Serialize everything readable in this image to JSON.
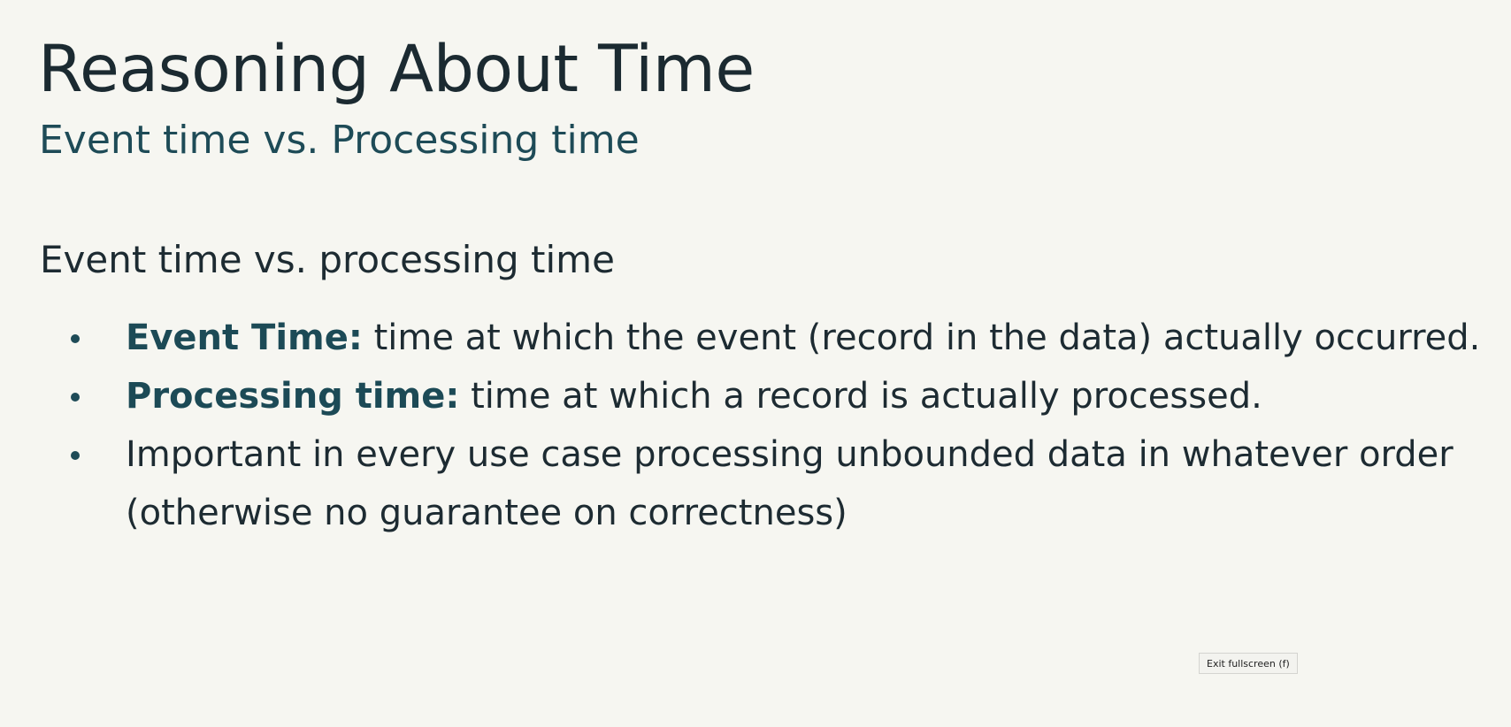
{
  "slide": {
    "title": "Reasoning About Time",
    "subtitle": "Event time vs. Processing time",
    "section_heading": "Event time vs. processing time",
    "bullets": [
      {
        "term": "Event Time:",
        "text": " time at which the event (record in the data) actually occurred."
      },
      {
        "term": "Processing time:",
        "text": " time at which a record is actually processed."
      },
      {
        "term": "",
        "text": "Important in every use case processing unbounded data in whatever order (otherwise no guarantee on correctness)"
      }
    ]
  },
  "controls": {
    "exit_fullscreen_label": "Exit fullscreen (f)"
  },
  "colors": {
    "background": "#f6f6f1",
    "text": "#1d2b32",
    "accent": "#1e4b57"
  }
}
